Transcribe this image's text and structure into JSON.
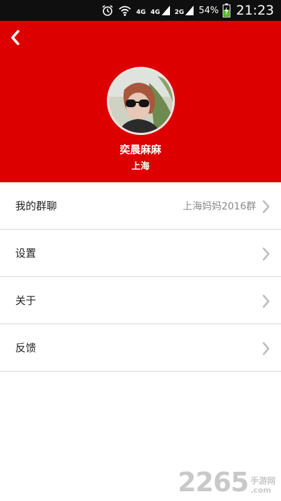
{
  "status_bar": {
    "net_label_1": "4G",
    "net_label_2": "4G",
    "net_label_3": "2G",
    "battery_percent": "54%",
    "time": "21:23",
    "icons": [
      "alarm-icon",
      "wifi-icon",
      "signal-icon",
      "signal-icon",
      "battery-charging-icon"
    ]
  },
  "header": {
    "background": "#dd0000",
    "back_icon": "chevron-left-icon"
  },
  "profile": {
    "name": "奕晨麻麻",
    "city": "上海"
  },
  "menu": {
    "items": [
      {
        "label": "我的群聊",
        "value": "上海妈妈2016群"
      },
      {
        "label": "设置"
      },
      {
        "label": "关于"
      },
      {
        "label": "反馈"
      }
    ]
  },
  "watermark": {
    "digits": "2265",
    "site_cn": "手游网",
    "site_dot": ".com"
  }
}
